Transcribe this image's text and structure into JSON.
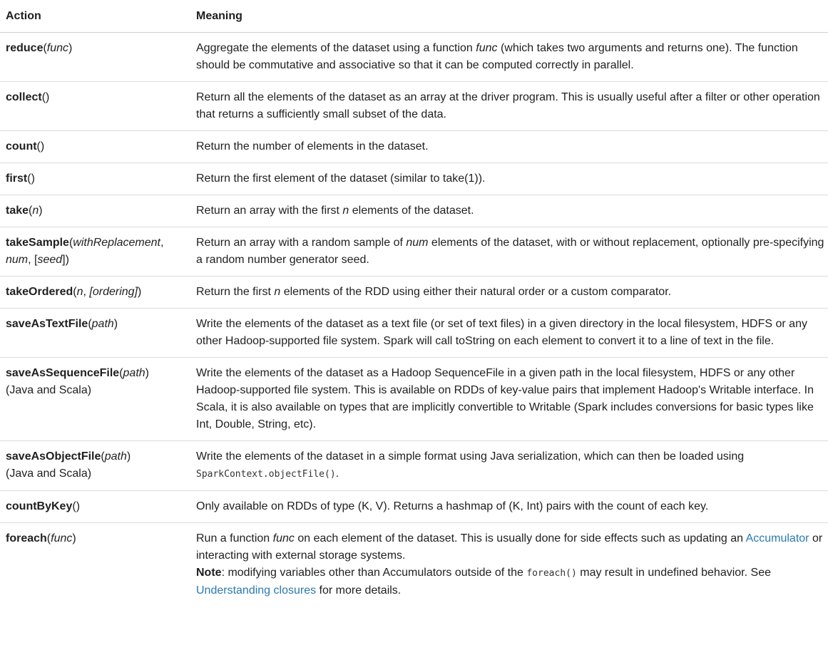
{
  "header": {
    "action": "Action",
    "meaning": "Meaning"
  },
  "rows": [
    {
      "name": "reduce",
      "args": [
        "(",
        "func",
        ")"
      ],
      "meaning": [
        "Aggregate the elements of the dataset using a function ",
        "func",
        " (which takes two arguments and returns one). The function should be commutative and associative so that it can be computed correctly in parallel."
      ]
    },
    {
      "name": "collect",
      "args": [
        "()"
      ],
      "meaning": [
        "Return all the elements of the dataset as an array at the driver program. This is usually useful after a filter or other operation that returns a sufficiently small subset of the data."
      ]
    },
    {
      "name": "count",
      "args": [
        "()"
      ],
      "meaning": [
        "Return the number of elements in the dataset."
      ]
    },
    {
      "name": "first",
      "args": [
        "()"
      ],
      "meaning": [
        "Return the first element of the dataset (similar to take(1))."
      ]
    },
    {
      "name": "take",
      "args": [
        "(",
        "n",
        ")"
      ],
      "meaning": [
        "Return an array with the first ",
        "n",
        " elements of the dataset."
      ]
    },
    {
      "name": "takeSample",
      "args": [
        "(",
        "withReplacement",
        ", ",
        "num",
        ", [",
        "seed",
        "])"
      ],
      "meaning": [
        "Return an array with a random sample of ",
        "num",
        " elements of the dataset, with or without replacement, optionally pre-specifying a random number generator seed."
      ]
    },
    {
      "name": "takeOrdered",
      "args": [
        "(",
        "n",
        ", ",
        "[ordering]",
        ")"
      ],
      "meaning": [
        "Return the first ",
        "n",
        " elements of the RDD using either their natural order or a custom comparator."
      ]
    },
    {
      "name": "saveAsTextFile",
      "args": [
        "(",
        "path",
        ")"
      ],
      "meaning": [
        "Write the elements of the dataset as a text file (or set of text files) in a given directory in the local filesystem, HDFS or any other Hadoop-supported file system. Spark will call toString on each element to convert it to a line of text in the file."
      ]
    },
    {
      "name": "saveAsSequenceFile",
      "args": [
        "(",
        "path",
        ")"
      ],
      "note": "(Java and Scala)",
      "meaning": [
        "Write the elements of the dataset as a Hadoop SequenceFile in a given path in the local filesystem, HDFS or any other Hadoop-supported file system. This is available on RDDs of key-value pairs that implement Hadoop's Writable interface. In Scala, it is also available on types that are implicitly convertible to Writable (Spark includes conversions for basic types like Int, Double, String, etc)."
      ]
    },
    {
      "name": "saveAsObjectFile",
      "args": [
        "(",
        "path",
        ")"
      ],
      "note": "(Java and Scala)",
      "meaning": [
        "Write the elements of the dataset in a simple format using Java serialization, which can then be loaded using "
      ],
      "code": "SparkContext.objectFile()",
      "meaning_after": "."
    },
    {
      "name": "countByKey",
      "args": [
        "()"
      ],
      "meaning": [
        "Only available on RDDs of type (K, V). Returns a hashmap of (K, Int) pairs with the count of each key."
      ]
    },
    {
      "name": "foreach",
      "args": [
        "(",
        "func",
        ")"
      ],
      "meaning": [
        "Run a function ",
        "func",
        " on each element of the dataset. This is usually done for side effects such as updating an "
      ],
      "link1": "Accumulator",
      "meaning2": " or interacting with external storage systems.",
      "note_label": "Note",
      "note_text": ": modifying variables other than Accumulators outside of the ",
      "note_code": "foreach()",
      "note_text2": " may result in undefined behavior. See ",
      "link2": "Understanding closures",
      "note_text3": " for more details."
    }
  ]
}
